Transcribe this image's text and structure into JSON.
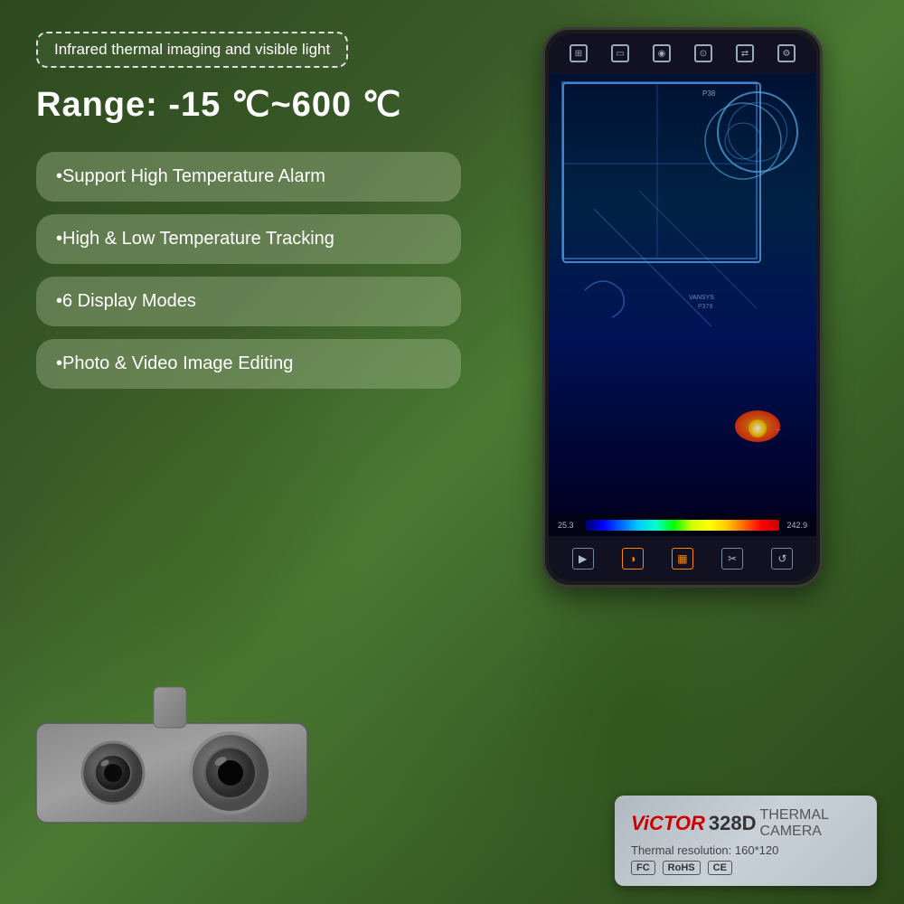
{
  "background": {
    "color_start": "#2d4a1e",
    "color_end": "#3a6028"
  },
  "header": {
    "title_badge": "Infrared thermal imaging and visible light"
  },
  "range": {
    "label": "Range: -15 ℃~600 ℃"
  },
  "features": [
    {
      "id": "feature-1",
      "text": "•Support High Temperature Alarm"
    },
    {
      "id": "feature-2",
      "text": "•High & Low Temperature Tracking"
    },
    {
      "id": "feature-3",
      "text": "•6 Display Modes"
    },
    {
      "id": "feature-4",
      "text": "•Photo & Video Image Editing"
    }
  ],
  "phone": {
    "topbar_icons": [
      "grid",
      "phone",
      "camera",
      "settings",
      "transfer",
      "gear"
    ],
    "colorbar": {
      "left_temp": "25.3",
      "right_temp": "242.9"
    },
    "bottombar_icons": [
      "play",
      "palette",
      "thermal",
      "tools",
      "refresh"
    ]
  },
  "victor_label": {
    "brand": "ViCTOR",
    "model": "328D",
    "category": "THERMAL CAMERA",
    "resolution_label": "Thermal resolution:",
    "resolution_value": "160*120",
    "certifications": [
      "FC",
      "RoHS",
      "CE"
    ]
  }
}
